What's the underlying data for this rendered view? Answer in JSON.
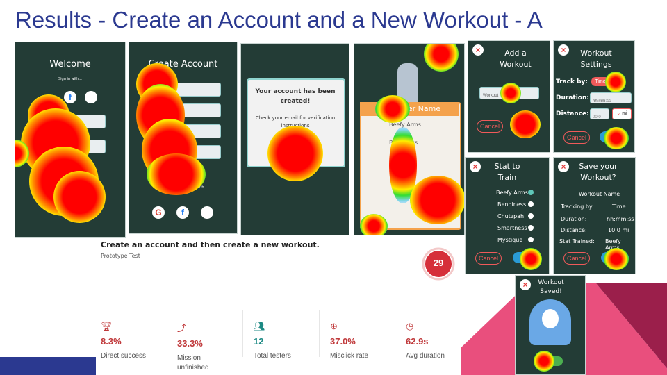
{
  "title": "Results - Create an Account and a New Workout - A",
  "welcome": {
    "heading": "Welcome",
    "sign_in_with": "Sign in with..."
  },
  "create_account": {
    "heading": "Create Account",
    "partial_text": "an account with..."
  },
  "account_created": {
    "line1": "Your account has been created!",
    "line2": "Check your email for verification instructions"
  },
  "character": {
    "banner": "Character Name",
    "stats": [
      "Beefy Arms",
      "Bendiness",
      "Chutzpah"
    ]
  },
  "add_workout": {
    "heading": "Add a Workout",
    "field_value": "Workout",
    "cancel": "Cancel"
  },
  "workout_settings": {
    "heading": "Workout Settings",
    "track_by": "Track by:",
    "track_value": "Time",
    "duration": "Duration:",
    "duration_value": "hh:mm:ss",
    "distance": "Distance:",
    "distance_value": "00.0",
    "unit": "mi",
    "cancel": "Cancel"
  },
  "stat_to_train": {
    "heading": "Stat to Train",
    "options": [
      "Beefy Arms",
      "Bendiness",
      "Chutzpah",
      "Smartness",
      "Mystique"
    ],
    "cancel": "Cancel"
  },
  "save_workout": {
    "heading": "Save your Workout?",
    "name": "Workout Name",
    "tracking_label": "Tracking by:",
    "tracking_value": "Time",
    "duration_label": "Duration:",
    "duration_value": "hh:mm:ss",
    "distance_label": "Distance:",
    "distance_value": "10.0 mi",
    "stat_label": "Stat Trained:",
    "stat_value": "Beefy Arms",
    "cancel": "Cancel"
  },
  "workout_saved": {
    "heading": "Workout Saved!"
  },
  "test": {
    "title": "Create an account and then create a new workout.",
    "subtitle": "Prototype Test",
    "score": "29"
  },
  "stats": [
    {
      "icon": "trophy-icon",
      "value": "8.3%",
      "label": "Direct success",
      "color": "#c0393b"
    },
    {
      "icon": "mission-icon",
      "value": "33.3%",
      "label": "Mission unfinished",
      "color": "#c0393b"
    },
    {
      "icon": "users-icon",
      "value": "12",
      "label": "Total testers",
      "color": "#1d8a84"
    },
    {
      "icon": "misclick-icon",
      "value": "37.0%",
      "label": "Misclick rate",
      "color": "#c0393b"
    },
    {
      "icon": "clock-icon",
      "value": "62.9s",
      "label": "Avg duration",
      "color": "#c0393b"
    }
  ]
}
